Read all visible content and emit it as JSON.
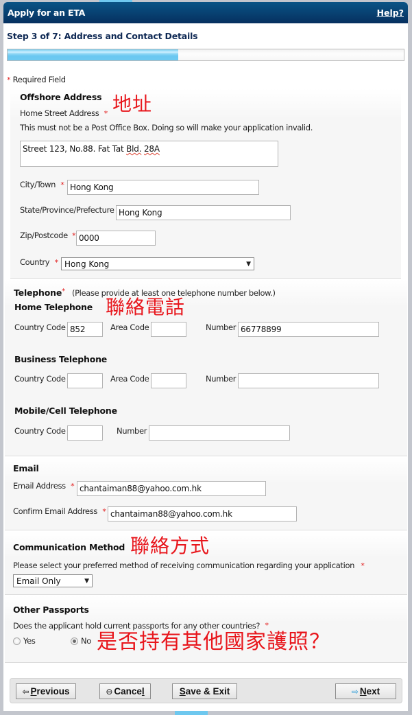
{
  "window": {
    "title": "Apply for an ETA",
    "help_link": "Help?"
  },
  "step": {
    "label": "Step 3 of 7: Address and Contact Details",
    "current": 3,
    "total": 7,
    "progress_fraction": 0.43
  },
  "required_note": {
    "star": "*",
    "text": "Required Field"
  },
  "offshore_address": {
    "heading": "Offshore Address",
    "annotation": "地址",
    "street_label": "Home Street Address",
    "street_note": "This must not be a Post Office Box. Doing so will make your application invalid.",
    "street_value_prefix": "Street 123, No.88. Fat Tat ",
    "street_value_misspelled_1": "Bld.",
    "street_value_space": " ",
    "street_value_misspelled_2": "28A",
    "city_label": "City/Town",
    "city_value": "Hong Kong",
    "state_label": "State/Province/Prefecture",
    "state_value": "Hong Kong",
    "zip_label": "Zip/Postcode",
    "zip_value": "0000",
    "country_label": "Country",
    "country_value": "Hong Kong",
    "star": "*"
  },
  "telephone": {
    "heading": "Telephone",
    "star": "*",
    "note": "(Please provide at least one telephone number below.)",
    "annotation": "聯絡電話",
    "home": {
      "heading": "Home Telephone",
      "country_code_label": "Country Code",
      "country_code_value": "852",
      "area_code_label": "Area Code",
      "area_code_value": "",
      "number_label": "Number",
      "number_value": "66778899"
    },
    "business": {
      "heading": "Business Telephone",
      "country_code_label": "Country Code",
      "country_code_value": "",
      "area_code_label": "Area Code",
      "area_code_value": "",
      "number_label": "Number",
      "number_value": ""
    },
    "mobile": {
      "heading": "Mobile/Cell Telephone",
      "country_code_label": "Country Code",
      "country_code_value": "",
      "number_label": "Number",
      "number_value": ""
    }
  },
  "email": {
    "heading": "Email",
    "address_label": "Email Address",
    "address_value": "chantaiman88@yahoo.com.hk",
    "confirm_label": "Confirm Email Address",
    "confirm_value": "chantaiman88@yahoo.com.hk",
    "star": "*"
  },
  "communication": {
    "heading": "Communication Method",
    "annotation": "聯絡方式",
    "prompt": "Please select your preferred method of receiving communication regarding your application",
    "star": "*",
    "selected": "Email Only"
  },
  "other_passports": {
    "heading": "Other Passports",
    "question": "Does the applicant hold current passports for any other countries?",
    "star": "*",
    "options": [
      {
        "label": "Yes",
        "checked": false
      },
      {
        "label": "No",
        "checked": true
      }
    ],
    "annotation": "是否持有其他國家護照？"
  },
  "footer": {
    "previous": {
      "icon": "⇦",
      "accel": "P",
      "rest": "revious"
    },
    "cancel": {
      "icon": "⊖",
      "pre": "Cance",
      "accel": "l"
    },
    "save_exit": {
      "accel": "S",
      "rest": "ave & Exit"
    },
    "next": {
      "icon": "⇨",
      "accel": "N",
      "rest": "ext"
    }
  },
  "colors": {
    "titlebar": "#06305f",
    "accent": "#6ec8ef",
    "required_star": "#e21c1c",
    "annotation": "#e8161c"
  }
}
